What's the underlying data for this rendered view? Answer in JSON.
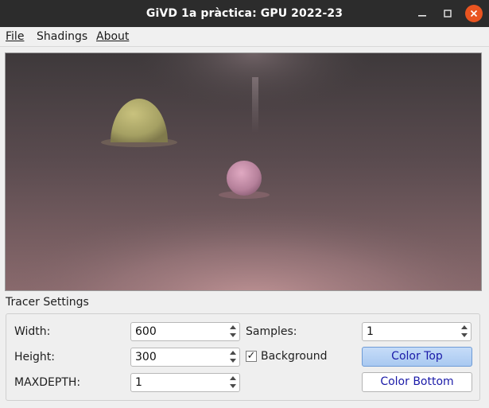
{
  "window": {
    "title": "GiVD 1a pràctica: GPU 2022-23"
  },
  "menu": {
    "file": "File",
    "shadings": "Shadings",
    "about": "About"
  },
  "render": {
    "description_colors": {
      "top": "#3f3a3c",
      "bottom": "#b88a8c",
      "sphere_yellow": "#c8c07a",
      "sphere_pink": "#d79bb6"
    }
  },
  "tracer_settings": {
    "group_title": "Tracer Settings",
    "width_label": "Width:",
    "width_value": "600",
    "height_label": "Height:",
    "height_value": "300",
    "maxdepth_label": "MAXDEPTH:",
    "maxdepth_value": "1",
    "samples_label": "Samples:",
    "samples_value": "1",
    "background_label": "Background",
    "background_checked": true,
    "background_check_glyph": "✓",
    "color_top_label": "Color Top",
    "color_bottom_label": "Color Bottom"
  },
  "icons": {
    "minimize": "minimize-icon",
    "maximize": "maximize-icon",
    "close": "close-icon",
    "spin_up": "arrow-up-icon",
    "spin_down": "arrow-down-icon"
  }
}
